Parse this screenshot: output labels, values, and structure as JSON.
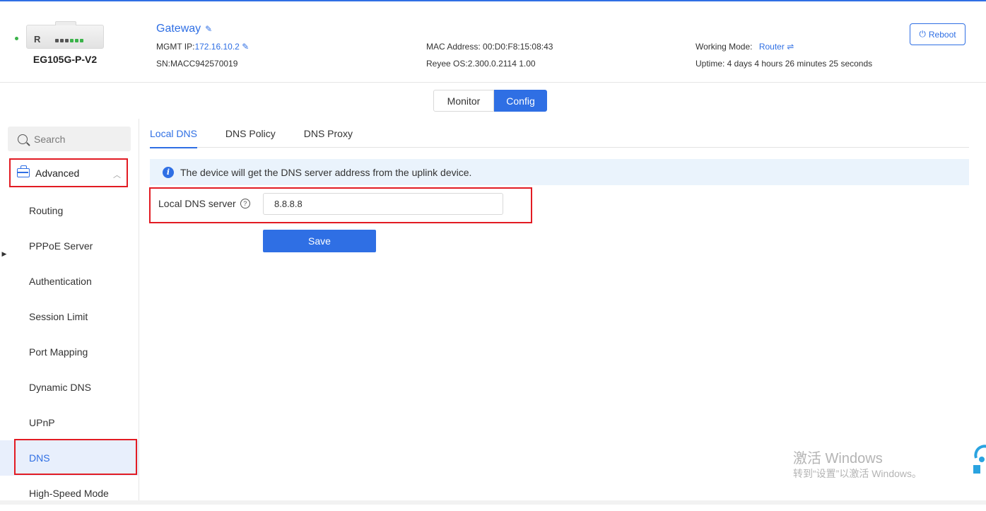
{
  "header": {
    "device_model": "EG105G-P-V2",
    "device_logo": "R",
    "device_name": "Gateway",
    "mgmt_ip_label": "MGMT IP:",
    "mgmt_ip": "172.16.10.2",
    "sn": "SN:MACC942570019",
    "mac": "MAC Address: 00:D0:F8:15:08:43",
    "os": "Reyee OS:2.300.0.2114 1.00",
    "working_mode_label": "Working Mode:",
    "working_mode": "Router",
    "uptime": "Uptime: 4 days 4 hours 26 minutes 25 seconds",
    "reboot_label": "Reboot",
    "status_color": "#3bb34a"
  },
  "mode_toggle": {
    "monitor": "Monitor",
    "config": "Config",
    "active": "config"
  },
  "sidebar": {
    "search_placeholder": "Search",
    "group_label": "Advanced",
    "items": [
      {
        "label": "Routing"
      },
      {
        "label": "PPPoE Server"
      },
      {
        "label": "Authentication"
      },
      {
        "label": "Session Limit"
      },
      {
        "label": "Port Mapping"
      },
      {
        "label": "Dynamic DNS"
      },
      {
        "label": "UPnP"
      },
      {
        "label": "DNS"
      },
      {
        "label": "High-Speed Mode"
      }
    ],
    "active_item": "DNS"
  },
  "tabs": [
    {
      "label": "Local DNS"
    },
    {
      "label": "DNS Policy"
    },
    {
      "label": "DNS Proxy"
    }
  ],
  "active_tab": "Local DNS",
  "alert": {
    "text": "The device will get the DNS server address from the uplink device."
  },
  "form": {
    "local_dns_label": "Local DNS server",
    "local_dns_value": "8.8.8.8",
    "save_label": "Save"
  },
  "watermark": {
    "line1": "激活 Windows",
    "line2": "转到“设置”以激活 Windows。"
  },
  "colors": {
    "accent": "#2f6fe4",
    "highlight": "#e21b23",
    "alert_bg": "#eaf3fc"
  }
}
